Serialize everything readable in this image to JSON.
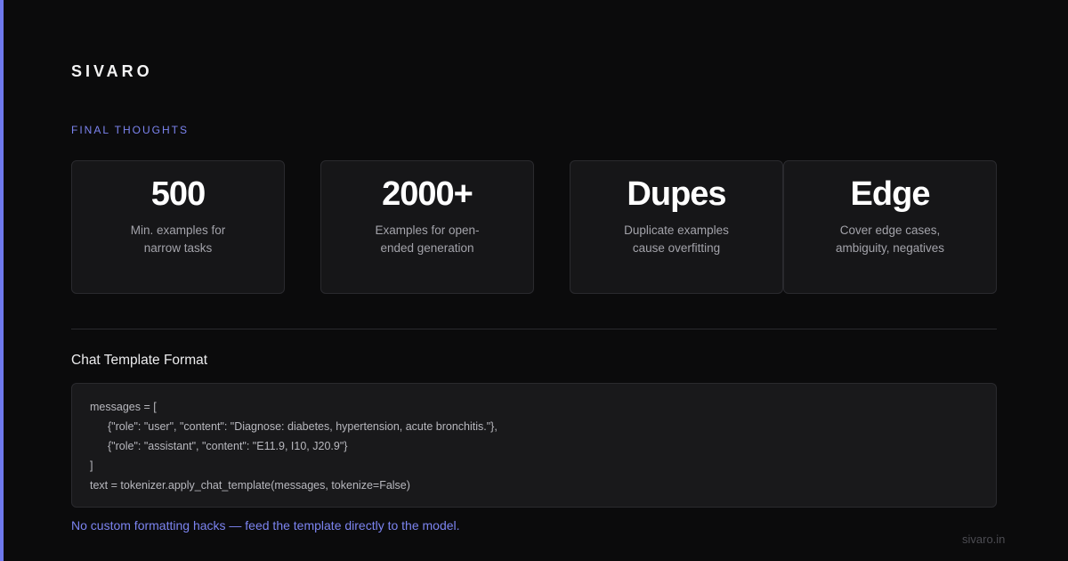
{
  "brand": "SIVARO",
  "section_label": "FINAL THOUGHTS",
  "stats": [
    {
      "value": "500",
      "description": "Min. examples for narrow tasks"
    },
    {
      "value": "2000+",
      "description": "Examples for open-ended generation"
    },
    {
      "value": "Dupes",
      "description": "Duplicate examples cause overfitting"
    },
    {
      "value": "Edge",
      "description": "Cover edge cases, ambiguity, negatives"
    }
  ],
  "code_section": {
    "title": "Chat Template Format",
    "lines": [
      "messages = [",
      "{\"role\": \"user\", \"content\": \"Diagnose: diabetes, hypertension, acute bronchitis.\"},",
      "{\"role\": \"assistant\", \"content\": \"E11.9, I10, J20.9\"}",
      "]",
      "text = tokenizer.apply_chat_template(messages, tokenize=False)"
    ]
  },
  "footnote": "No custom formatting hacks — feed the template directly to the model.",
  "site_url": "sivaro.in",
  "colors": {
    "background": "#0b0b0c",
    "accent": "#6f79ee",
    "card": "#161618",
    "text_muted": "#a3a3aa"
  }
}
